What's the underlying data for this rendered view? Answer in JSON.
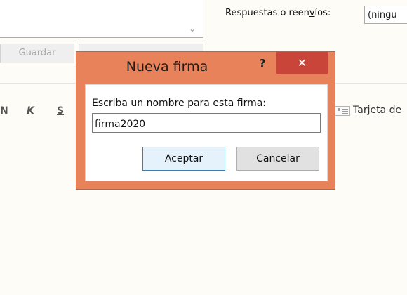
{
  "background": {
    "replies_label_pre": "Respuestas o reen",
    "replies_label_accel": "v",
    "replies_label_post": "íos:",
    "replies_value": "(ningu",
    "save_button": "Guardar",
    "format": {
      "bold": "N",
      "italic": "K",
      "underline": "S"
    },
    "business_card_label": "Tarjeta de"
  },
  "dialog": {
    "title": "Nueva firma",
    "help": "?",
    "close": "✕",
    "prompt_accel": "E",
    "prompt_rest": "scriba un nombre para esta firma:",
    "name_value": "firma2020",
    "ok_label": "Aceptar",
    "cancel_label": "Cancelar"
  },
  "colors": {
    "dialog_frame": "#e8825a",
    "close_button": "#c9453a",
    "ok_button_border": "#3c7fb1"
  }
}
